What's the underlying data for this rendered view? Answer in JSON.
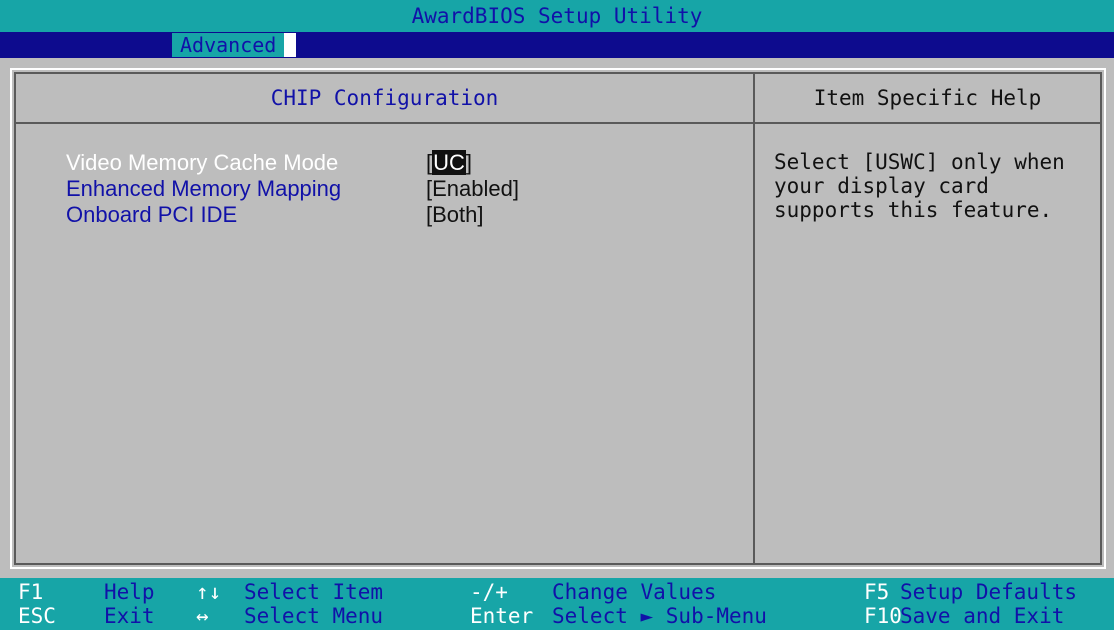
{
  "window": {
    "title": "AwardBIOS Setup Utility"
  },
  "menu": {
    "active_tab": "Advanced"
  },
  "panel": {
    "title": "CHIP Configuration",
    "help_title": "Item Specific Help",
    "items": [
      {
        "label": "Video Memory Cache Mode",
        "value_prefix": "[",
        "value_highlight": "UC",
        "value_suffix": "]",
        "selected": true
      },
      {
        "label": "Enhanced Memory Mapping",
        "value": "[Enabled]"
      },
      {
        "label": "Onboard PCI IDE",
        "value": "[Both]"
      }
    ],
    "help_lines": [
      "Select [USWC] only when",
      "your display card",
      "supports this feature."
    ]
  },
  "footer": {
    "row1": [
      {
        "key": "F1",
        "desc": "Help"
      },
      {
        "key": "↑↓",
        "desc": "Select Item"
      },
      {
        "key": "-/+",
        "desc": "Change Values"
      },
      {
        "key": "F5",
        "desc": "Setup Defaults"
      }
    ],
    "row2": [
      {
        "key": "ESC",
        "desc": "Exit"
      },
      {
        "key": "↔",
        "desc": "Select Menu"
      },
      {
        "key": "Enter",
        "desc": "Select ► Sub-Menu"
      },
      {
        "key": "F10",
        "desc": "Save and Exit"
      }
    ]
  }
}
